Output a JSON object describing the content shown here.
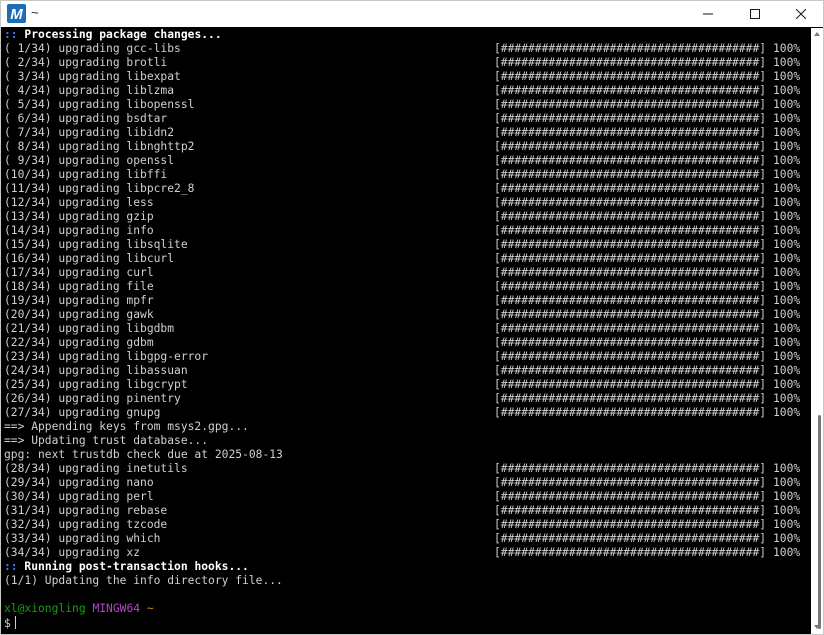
{
  "window": {
    "title": "~",
    "app_icon_letter": "M",
    "icons": {
      "app": "msys2-icon",
      "minimize": "minimize-icon",
      "maximize": "maximize-icon",
      "close": "close-icon"
    }
  },
  "colors": {
    "terminal_bg": "#000000",
    "text": "#d0d0d0",
    "blue_prefix": "#3b78ff",
    "prompt_user": "#13a10e",
    "prompt_system": "#b148c6",
    "prompt_path": "#c19c00",
    "app_icon_bg": "#1e6bb8"
  },
  "terminal": {
    "lines": [
      {
        "type": "header",
        "prefix": "::",
        "text": " Processing package changes..."
      },
      {
        "type": "pkg",
        "text": "( 1/34) upgrading gcc-libs",
        "bar": "[######################################]",
        "pct": "100%"
      },
      {
        "type": "pkg",
        "text": "( 2/34) upgrading brotli",
        "bar": "[######################################]",
        "pct": "100%"
      },
      {
        "type": "pkg",
        "text": "( 3/34) upgrading libexpat",
        "bar": "[######################################]",
        "pct": "100%"
      },
      {
        "type": "pkg",
        "text": "( 4/34) upgrading liblzma",
        "bar": "[######################################]",
        "pct": "100%"
      },
      {
        "type": "pkg",
        "text": "( 5/34) upgrading libopenssl",
        "bar": "[######################################]",
        "pct": "100%"
      },
      {
        "type": "pkg",
        "text": "( 6/34) upgrading bsdtar",
        "bar": "[######################################]",
        "pct": "100%"
      },
      {
        "type": "pkg",
        "text": "( 7/34) upgrading libidn2",
        "bar": "[######################################]",
        "pct": "100%"
      },
      {
        "type": "pkg",
        "text": "( 8/34) upgrading libnghttp2",
        "bar": "[######################################]",
        "pct": "100%"
      },
      {
        "type": "pkg",
        "text": "( 9/34) upgrading openssl",
        "bar": "[######################################]",
        "pct": "100%"
      },
      {
        "type": "pkg",
        "text": "(10/34) upgrading libffi",
        "bar": "[######################################]",
        "pct": "100%"
      },
      {
        "type": "pkg",
        "text": "(11/34) upgrading libpcre2_8",
        "bar": "[######################################]",
        "pct": "100%"
      },
      {
        "type": "pkg",
        "text": "(12/34) upgrading less",
        "bar": "[######################################]",
        "pct": "100%"
      },
      {
        "type": "pkg",
        "text": "(13/34) upgrading gzip",
        "bar": "[######################################]",
        "pct": "100%"
      },
      {
        "type": "pkg",
        "text": "(14/34) upgrading info",
        "bar": "[######################################]",
        "pct": "100%"
      },
      {
        "type": "pkg",
        "text": "(15/34) upgrading libsqlite",
        "bar": "[######################################]",
        "pct": "100%"
      },
      {
        "type": "pkg",
        "text": "(16/34) upgrading libcurl",
        "bar": "[######################################]",
        "pct": "100%"
      },
      {
        "type": "pkg",
        "text": "(17/34) upgrading curl",
        "bar": "[######################################]",
        "pct": "100%"
      },
      {
        "type": "pkg",
        "text": "(18/34) upgrading file",
        "bar": "[######################################]",
        "pct": "100%"
      },
      {
        "type": "pkg",
        "text": "(19/34) upgrading mpfr",
        "bar": "[######################################]",
        "pct": "100%"
      },
      {
        "type": "pkg",
        "text": "(20/34) upgrading gawk",
        "bar": "[######################################]",
        "pct": "100%"
      },
      {
        "type": "pkg",
        "text": "(21/34) upgrading libgdbm",
        "bar": "[######################################]",
        "pct": "100%"
      },
      {
        "type": "pkg",
        "text": "(22/34) upgrading gdbm",
        "bar": "[######################################]",
        "pct": "100%"
      },
      {
        "type": "pkg",
        "text": "(23/34) upgrading libgpg-error",
        "bar": "[######################################]",
        "pct": "100%"
      },
      {
        "type": "pkg",
        "text": "(24/34) upgrading libassuan",
        "bar": "[######################################]",
        "pct": "100%"
      },
      {
        "type": "pkg",
        "text": "(25/34) upgrading libgcrypt",
        "bar": "[######################################]",
        "pct": "100%"
      },
      {
        "type": "pkg",
        "text": "(26/34) upgrading pinentry",
        "bar": "[######################################]",
        "pct": "100%"
      },
      {
        "type": "pkg",
        "text": "(27/34) upgrading gnupg",
        "bar": "[######################################]",
        "pct": "100%"
      },
      {
        "type": "plain",
        "text": "==> Appending keys from msys2.gpg..."
      },
      {
        "type": "plain",
        "text": "==> Updating trust database..."
      },
      {
        "type": "plain",
        "text": "gpg: next trustdb check due at 2025-08-13"
      },
      {
        "type": "pkg",
        "text": "(28/34) upgrading inetutils",
        "bar": "[######################################]",
        "pct": "100%"
      },
      {
        "type": "pkg",
        "text": "(29/34) upgrading nano",
        "bar": "[######################################]",
        "pct": "100%"
      },
      {
        "type": "pkg",
        "text": "(30/34) upgrading perl",
        "bar": "[######################################]",
        "pct": "100%"
      },
      {
        "type": "pkg",
        "text": "(31/34) upgrading rebase",
        "bar": "[######################################]",
        "pct": "100%"
      },
      {
        "type": "pkg",
        "text": "(32/34) upgrading tzcode",
        "bar": "[######################################]",
        "pct": "100%"
      },
      {
        "type": "pkg",
        "text": "(33/34) upgrading which",
        "bar": "[######################################]",
        "pct": "100%"
      },
      {
        "type": "pkg",
        "text": "(34/34) upgrading xz",
        "bar": "[######################################]",
        "pct": "100%"
      },
      {
        "type": "header",
        "prefix": "::",
        "text": " Running post-transaction hooks..."
      },
      {
        "type": "plain",
        "text": "(1/1) Updating the info directory file..."
      },
      {
        "type": "blank",
        "text": ""
      }
    ],
    "prompt": {
      "user_host": "xl@xiongling",
      "system": "MINGW64",
      "path": "~",
      "symbol": "$"
    }
  }
}
